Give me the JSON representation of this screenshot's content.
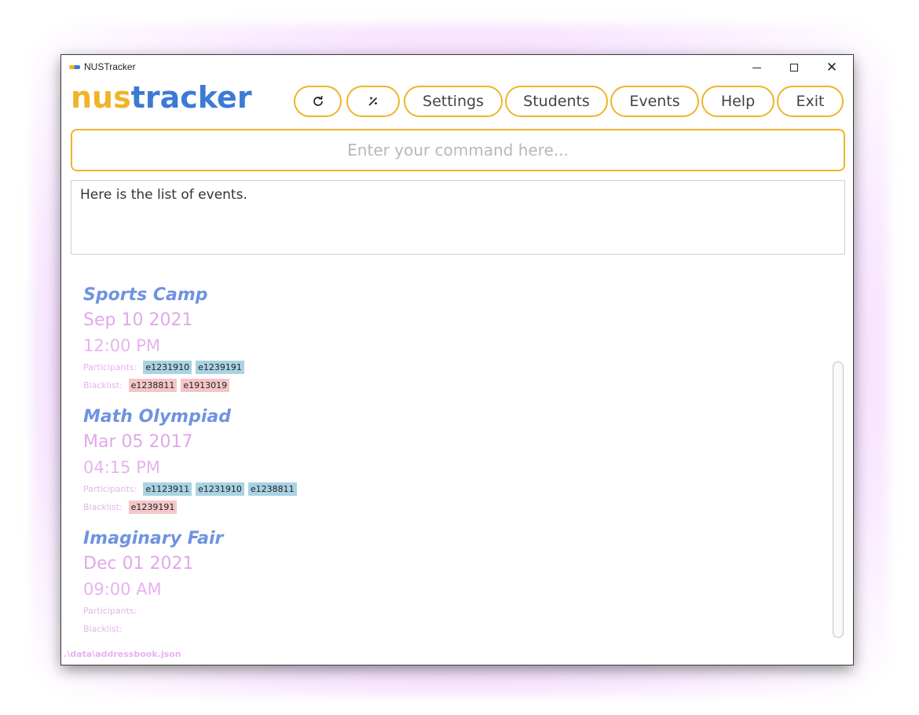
{
  "window": {
    "title": "NUSTracker",
    "controls": {
      "minimize": "minimize",
      "maximize": "maximize",
      "close": "✕"
    }
  },
  "logo": {
    "part1": "nus",
    "part2": "tracker"
  },
  "toolbar": {
    "refresh_icon": "refresh-icon",
    "magic_icon": "magic-wand-icon",
    "settings_label": "Settings",
    "students_label": "Students",
    "events_label": "Events",
    "help_label": "Help",
    "exit_label": "Exit"
  },
  "command": {
    "value": "",
    "placeholder": "Enter your command here..."
  },
  "result": {
    "text": "Here is the list of events."
  },
  "event_list": {
    "participants_label": "Participants:",
    "blacklist_label": "Blacklist:",
    "events": [
      {
        "name": "Sports Camp",
        "date": "Sep 10 2021",
        "time": "12:00 PM",
        "participants": [
          "e1231910",
          "e1239191"
        ],
        "blacklist": [
          "e1238811",
          "e1913019"
        ]
      },
      {
        "name": "Math Olympiad",
        "date": "Mar 05 2017",
        "time": "04:15 PM",
        "participants": [
          "e1123911",
          "e1231910",
          "e1238811"
        ],
        "blacklist": [
          "e1239191"
        ]
      },
      {
        "name": "Imaginary Fair",
        "date": "Dec 01 2021",
        "time": "09:00 AM",
        "participants": [],
        "blacklist": []
      }
    ]
  },
  "status": {
    "path": ".\\data\\addressbook.json"
  },
  "colors": {
    "accent_yellow": "#f0b429",
    "accent_blue": "#3b7bd4",
    "event_name": "#6f93e0",
    "event_date": "#e2a7ec",
    "participant_tag": "#a9d3e3",
    "blacklist_tag": "#f5c6c7"
  }
}
